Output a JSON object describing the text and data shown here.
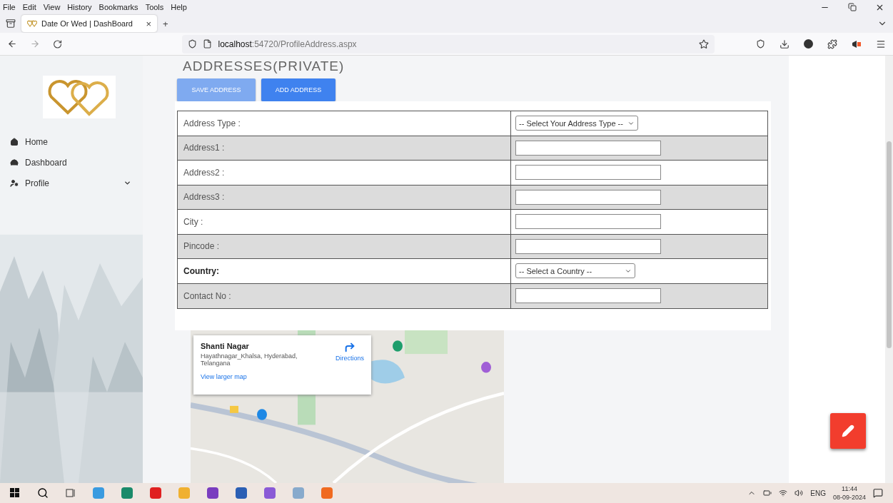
{
  "browser": {
    "menu": [
      "File",
      "Edit",
      "View",
      "History",
      "Bookmarks",
      "Tools",
      "Help"
    ],
    "tab": {
      "title": "Date Or Wed | DashBoard",
      "close": "×",
      "new_tab": "+"
    },
    "url": {
      "host": "localhost",
      "rest": ":54720/ProfileAddress.aspx"
    }
  },
  "sidebar": {
    "items": [
      {
        "label": "Home",
        "has_submenu": false
      },
      {
        "label": "Dashboard",
        "has_submenu": false
      },
      {
        "label": "Profile",
        "has_submenu": true
      }
    ]
  },
  "page": {
    "title": "ADDRESSES(PRIVATE)",
    "buttons": [
      {
        "label": "SAVE ADDRESS",
        "disabled": true
      },
      {
        "label": "ADD ADDRESS",
        "disabled": false
      }
    ],
    "form_rows": [
      {
        "label": "Address Type :",
        "kind": "select",
        "value": "-- Select Your Address Type --",
        "bold": false
      },
      {
        "label": "Address1 :",
        "kind": "input",
        "bold": false
      },
      {
        "label": "Address2 :",
        "kind": "input",
        "bold": false
      },
      {
        "label": "Address3 :",
        "kind": "input",
        "bold": false
      },
      {
        "label": "City :",
        "kind": "input",
        "bold": false
      },
      {
        "label": "Pincode :",
        "kind": "input",
        "bold": false
      },
      {
        "label": "Country:",
        "kind": "select",
        "value": "-- Select a Country --",
        "bold": true
      },
      {
        "label": "Contact No :",
        "kind": "input",
        "bold": false
      }
    ],
    "map": {
      "kind": "picture",
      "card": {
        "place": "Shanti Nagar",
        "address": "Hayathnagar_Khalsa, Hyderabad, Telangana",
        "link": "View larger map",
        "directions": "Directions"
      }
    }
  },
  "taskbar": {
    "language": "ENG",
    "time": "11:44",
    "date": "08-09-2024"
  }
}
